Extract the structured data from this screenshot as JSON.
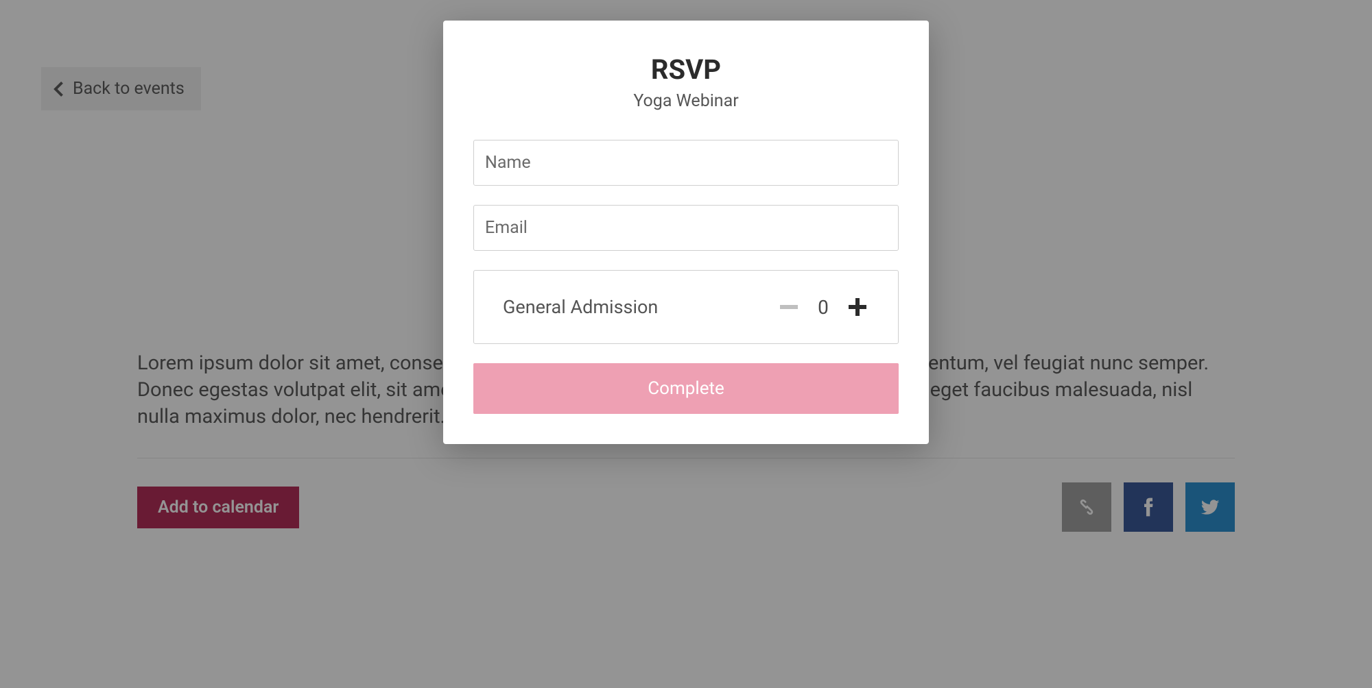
{
  "backButton": {
    "label": "Back to events"
  },
  "body": {
    "text": "Lorem ipsum dolor sit amet, consectetur adipiscing elit. Fusce finibus tellus et lorem elementum, vel feugiat nunc semper. Donec egestas volutpat elit, sit amet porta ante fermentum eget. Donec imperdiet, mauris eget faucibus malesuada, nisl nulla maximus dolor, nec hendrerit."
  },
  "actions": {
    "addToCalendar": "Add to calendar"
  },
  "modal": {
    "title": "RSVP",
    "subtitle": "Yoga Webinar",
    "namePlaceholder": "Name",
    "emailPlaceholder": "Email",
    "admissionLabel": "General Admission",
    "quantity": "0",
    "completeLabel": "Complete"
  },
  "accent": "#b62f5a"
}
